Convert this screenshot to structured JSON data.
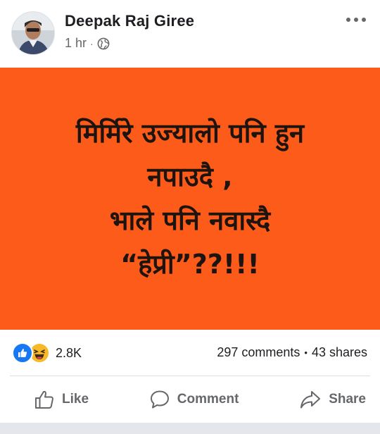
{
  "post": {
    "author": "Deepak Raj Giree",
    "time": "1 hr",
    "separator": "·",
    "privacy_icon": "globe-icon",
    "more_icon": "more-horizontal-icon",
    "image_text_lines": [
      "मिर्मिरे उज्यालो पनि हुन",
      "नपाउदै ,",
      "भाले पनि नवास्दै",
      "“हेप्री”??!!!"
    ],
    "image_background": "#fd5b19"
  },
  "stats": {
    "reaction_icons": [
      "like-reaction-icon",
      "haha-reaction-icon"
    ],
    "reaction_count": "2.8K",
    "comments": "297 comments",
    "dot": "•",
    "shares": "43 shares"
  },
  "actions": {
    "like": "Like",
    "comment": "Comment",
    "share": "Share"
  },
  "colors": {
    "accent": "#1877f2",
    "haha": "#f7b928",
    "muted_text": "#65676b"
  }
}
